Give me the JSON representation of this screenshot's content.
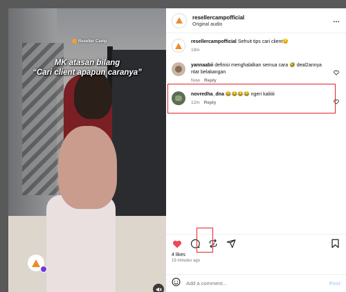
{
  "post": {
    "overlay_line1": "MK atasan bilang",
    "overlay_line2": "“Cari client apapun caranya”",
    "watermark": "Reseller Camp"
  },
  "header": {
    "username": "resellercampofficial",
    "audio": "Original audio",
    "more": "…"
  },
  "comments": [
    {
      "username": "resellercampofficial",
      "text": "Sefruit tips cari client😏",
      "time": "19m",
      "reply": ""
    },
    {
      "username": "yannaabii",
      "text": "definisi menghalalkan semua cara 🤣 deal2annya ntar belakangan",
      "time": "Now",
      "reply": "Reply"
    },
    {
      "username": "novredha_dna",
      "text": "😂😂😂😂 ngeri kaliiiii",
      "time": "12m",
      "reply": "Reply"
    }
  ],
  "actions": {
    "likes": "4 likes",
    "time_ago": "19 minutes ago"
  },
  "add_comment": {
    "placeholder": "Add a comment...",
    "post_label": "Post"
  },
  "colors": {
    "highlight": "#e0242c",
    "like": "#ed4956",
    "post_button": "#b3d3f5",
    "brand": "#f08a2a"
  }
}
